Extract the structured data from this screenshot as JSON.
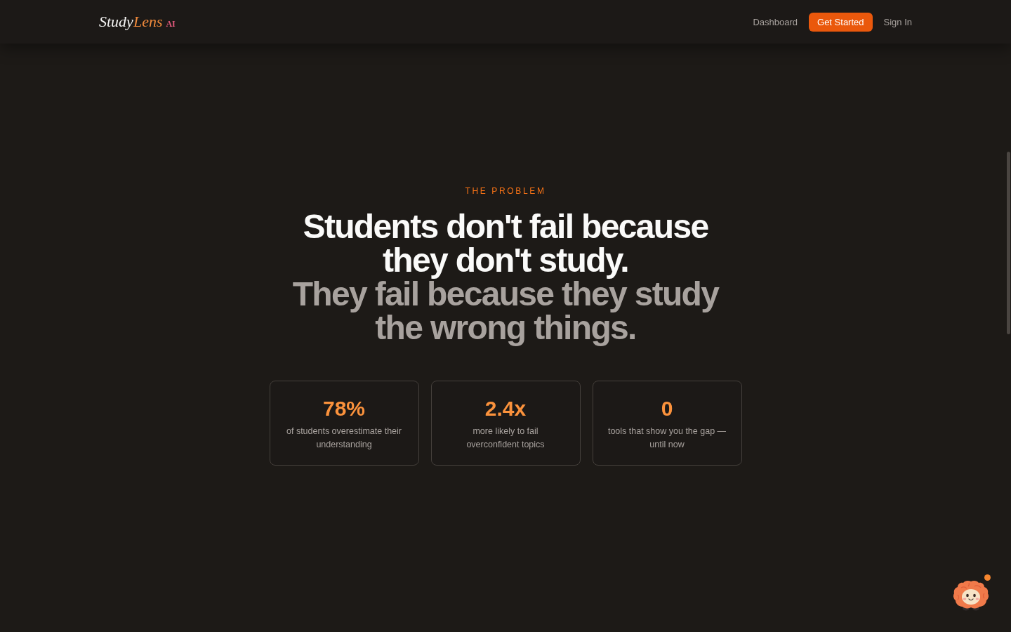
{
  "header": {
    "logo": {
      "primary": "Study",
      "accent": "Lens",
      "badge": "AI"
    },
    "nav": [
      {
        "label": "Dashboard",
        "kind": "link"
      },
      {
        "label": "Get Started",
        "kind": "button"
      },
      {
        "label": "Sign In",
        "kind": "link"
      }
    ]
  },
  "section": {
    "eyebrow": "THE PROBLEM",
    "headline": "Students don't fail because they don't study.",
    "subheadline": "They fail because they study the wrong things.",
    "stats": [
      {
        "value": "78%",
        "label": "of students overestimate their understanding"
      },
      {
        "value": "2.4x",
        "label": "more likely to fail overconfident topics"
      },
      {
        "value": "0",
        "label": "tools that show you the gap — until now"
      }
    ]
  },
  "assistant": {
    "notification": true
  }
}
